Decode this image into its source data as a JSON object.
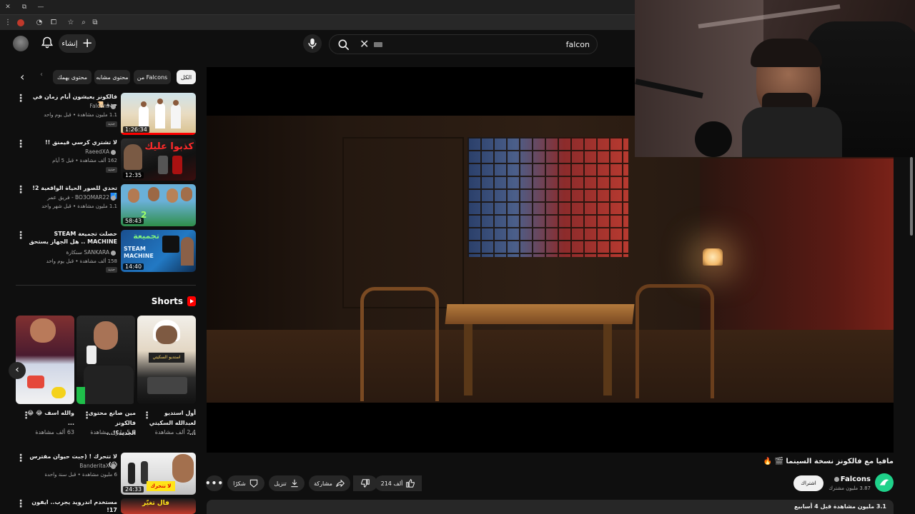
{
  "browser": {
    "controls": [
      "✕",
      "⧉",
      "—"
    ]
  },
  "header": {
    "create_label": "إنشاء",
    "search_value": "falcon"
  },
  "chips": [
    {
      "label": "الكل",
      "active": true
    },
    {
      "label": "من Falcons",
      "active": false
    },
    {
      "label": "محتوى مشابه",
      "active": false
    },
    {
      "label": "محتوى يهمك",
      "active": false
    }
  ],
  "sidebar_videos": [
    {
      "title": "فالكونز يعيشون أيام زمان في جدة 📜",
      "channel": "Falcons",
      "meta": "1.1 مليون مشاهدة • قبل يوم واحد",
      "badge": "جديد",
      "duration": "1:26:34",
      "progress": 1.0
    },
    {
      "title": "لا تشتري كرسي قيمنق !!",
      "channel": "RaeedXA",
      "meta": "162 ألف مشاهدة • قبل 5 أيام",
      "badge": "جديد",
      "duration": "12:35",
      "progress": 0
    },
    {
      "title": "تحدي للصور الحياة الواقعية 2! 🗾",
      "channel": "BO3OMAR22 - فريق عمر",
      "meta": "1.1 مليون مشاهدة • قبل شهر واحد",
      "badge": "",
      "duration": "58:43",
      "progress": 0
    },
    {
      "title": "حصلت تجميعة STEAM MACHINE .. هل الجهاز يستحق ؟",
      "channel": "SANKARA سنكارة",
      "meta": "158 ألف مشاهدة • قبل يوم واحد",
      "badge": "جديد",
      "duration": "14:40",
      "progress": 0
    }
  ],
  "shorts": {
    "label": "Shorts",
    "items": [
      {
        "title": "أول استديو لعبدالله السكيتي ...",
        "views": "2.4 ألف مشاهدة"
      },
      {
        "title": "مين صانع محتوى فالكونز الجديد؟!...",
        "views": "5.7 مليون مشاهدة"
      },
      {
        "title": "والله اسف 😂 😂 ...",
        "views": "63 ألف مشاهدة"
      }
    ]
  },
  "sidebar_videos_2": [
    {
      "title": "لا تتحرك ! (جبت حيوان مفترس 😱)",
      "channel": "BanderitaX",
      "meta": "6 مليون مشاهدة • قبل سنة واحدة",
      "duration": "24:33",
      "progress": 0
    },
    {
      "title": "مستخدم اندرويد يجرب.. ايفون 17!",
      "channel": "",
      "meta": "",
      "duration": "",
      "progress": 0
    }
  ],
  "video": {
    "title": "مافيا مع فالكونز نسخة السينما 🎬 🔥",
    "channel_name": "Falcons",
    "subscribers": "3.87 مليون مشترك",
    "subscribe_label": "اشتراك",
    "likes": "214 ألف",
    "share_label": "مشاركة",
    "download_label": "تنزيل",
    "thanks_label": "شكرًا",
    "description_meta": "3.1 مليون مشاهدة قبل 4 أسابيع"
  },
  "colors": {
    "accent": "#ff0000",
    "channel_logo": "#1fd18a",
    "background": "#0f0f0f"
  }
}
